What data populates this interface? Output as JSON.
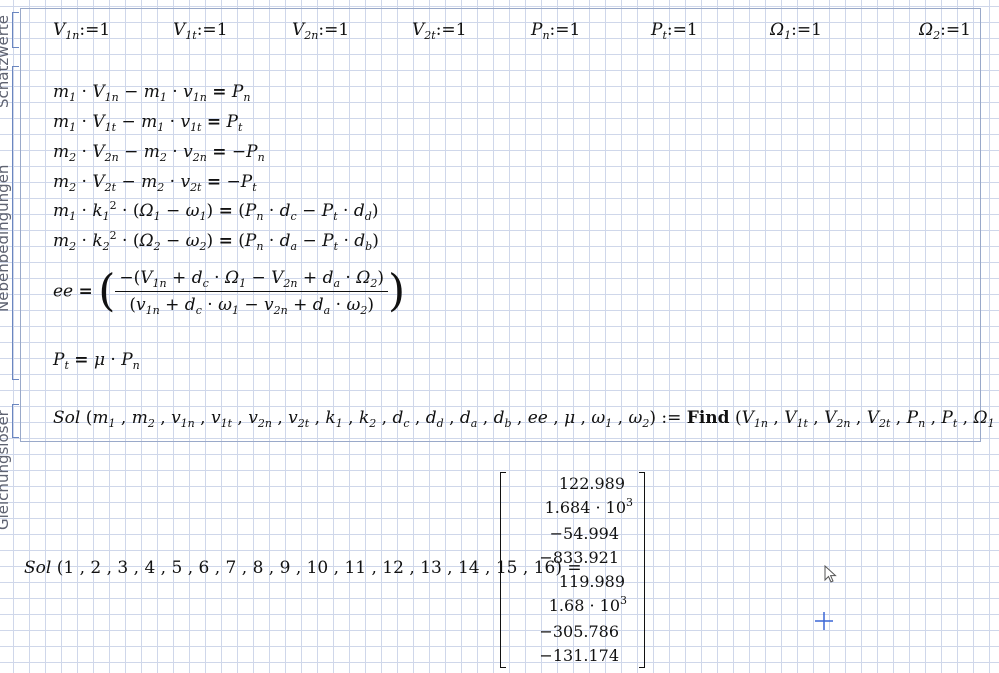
{
  "regions": {
    "schaetzwerte": "Schätzwerte",
    "nebenbedingungen": "Nebenbedingungen",
    "gleichungsloeser": "Gleichungslöser"
  },
  "guesses": [
    {
      "name": "V",
      "sub": "1n",
      "value": "1"
    },
    {
      "name": "V",
      "sub": "1t",
      "value": "1"
    },
    {
      "name": "V",
      "sub": "2n",
      "value": "1"
    },
    {
      "name": "V",
      "sub": "2t",
      "value": "1"
    },
    {
      "name": "P",
      "sub": "n",
      "value": "1"
    },
    {
      "name": "P",
      "sub": "t",
      "value": "1"
    },
    {
      "name": "Ω",
      "sub": "1",
      "value": "1"
    },
    {
      "name": "Ω",
      "sub": "2",
      "value": "1"
    }
  ],
  "assign_op": ":=",
  "find_keyword": "Find",
  "solver": {
    "function_name": "Sol",
    "call_args": "1 , 2 , 3 , 4 , 5 , 6 , 7 , 8 , 9 , 10 , 11 , 12 , 13 , 14 , 15 , 16"
  },
  "result_vector": [
    {
      "mantissa": "122.989",
      "exp": ""
    },
    {
      "mantissa": "1.684",
      "exp": "3"
    },
    {
      "mantissa": "−54.994",
      "exp": ""
    },
    {
      "mantissa": "−833.921",
      "exp": ""
    },
    {
      "mantissa": "119.989",
      "exp": ""
    },
    {
      "mantissa": "1.68",
      "exp": "3"
    },
    {
      "mantissa": "−305.786",
      "exp": ""
    },
    {
      "mantissa": "−131.174",
      "exp": ""
    }
  ],
  "exp_base": "10"
}
